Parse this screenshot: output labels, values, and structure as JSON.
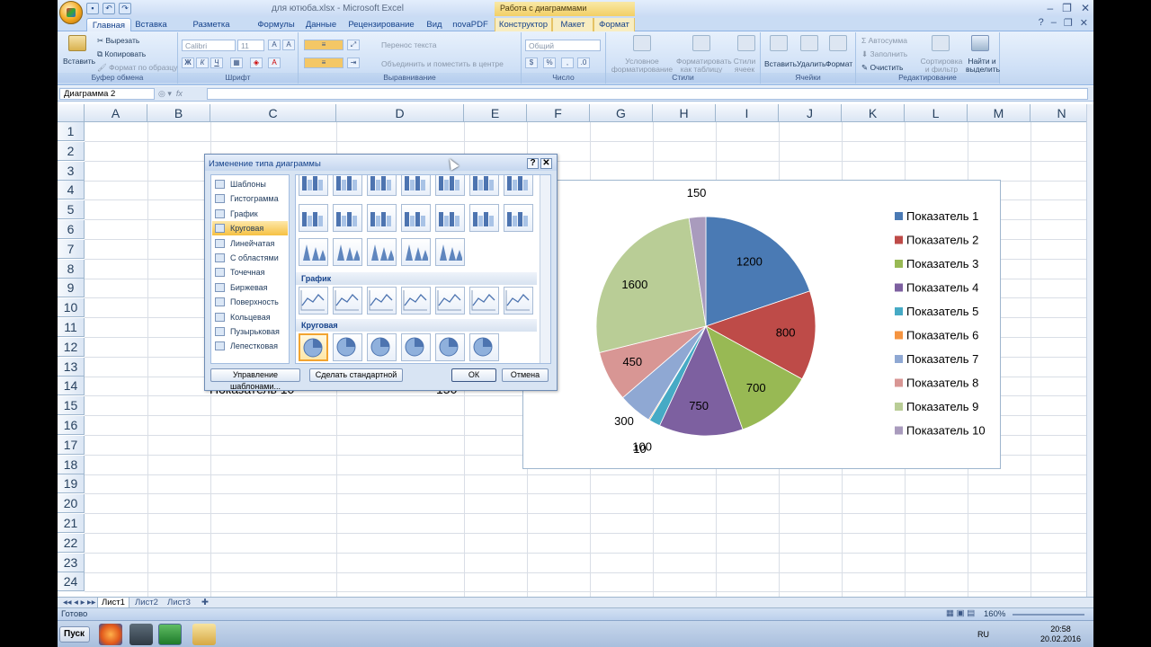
{
  "window": {
    "title": "для ютюба.xlsx - Microsoft Excel",
    "context_title": "Работа с диаграммами",
    "controls": [
      "–",
      "❐",
      "✕"
    ]
  },
  "tabs": [
    "Главная",
    "Вставка",
    "Разметка страницы",
    "Формулы",
    "Данные",
    "Рецензирование",
    "Вид",
    "novaPDF",
    "Конструктор",
    "Макет",
    "Формат"
  ],
  "ribbon": {
    "clipboard": {
      "paste": "Вставить",
      "cut": "Вырезать",
      "copy": "Копировать",
      "format": "Формат по образцу",
      "label": "Буфер обмена"
    },
    "font": {
      "name": "Calibri",
      "size": "11",
      "label": "Шрифт",
      "bold": "Ж",
      "italic": "К",
      "underline": "Ч"
    },
    "align": {
      "wrap": "Перенос текста",
      "merge": "Объединить и поместить в центре",
      "label": "Выравнивание"
    },
    "number": {
      "format": "Общий",
      "label": "Число"
    },
    "styles": {
      "conditional": "Условное форматирование",
      "as_table": "Форматировать как таблицу",
      "cell_styles": "Стили ячеек",
      "label": "Стили"
    },
    "cells": {
      "insert": "Вставить",
      "delete": "Удалить",
      "format": "Формат",
      "label": "Ячейки"
    },
    "editing": {
      "autosum": "Автосумма",
      "fill": "Заполнить",
      "clear": "Очистить",
      "sort": "Сортировка и фильтр",
      "find": "Найти и выделить",
      "label": "Редактирование"
    }
  },
  "formula_bar": {
    "name_box": "Диаграмма 2",
    "fx": "fx"
  },
  "columns": [
    "A",
    "B",
    "C",
    "D",
    "E",
    "F",
    "G",
    "H",
    "I",
    "J",
    "K",
    "L",
    "M",
    "N"
  ],
  "rows": [
    "1",
    "2",
    "3",
    "4",
    "5",
    "6",
    "7",
    "8",
    "9",
    "10",
    "11",
    "12",
    "13",
    "14",
    "15",
    "16",
    "17",
    "18",
    "19",
    "20",
    "21",
    "22",
    "23",
    "24"
  ],
  "cells": {
    "a14": "Показатель 10",
    "d14": "150"
  },
  "dialog": {
    "title": "Изменение типа диаграммы",
    "help": "?",
    "close": "✕",
    "categories": [
      "Шаблоны",
      "Гистограмма",
      "График",
      "Круговая",
      "Линейчатая",
      "С областями",
      "Точечная",
      "Биржевая",
      "Поверхность",
      "Кольцевая",
      "Пузырьковая",
      "Лепестковая"
    ],
    "selected_category": "Круговая",
    "section_line": "График",
    "section_pie": "Круговая",
    "btn_templates": "Управление шаблонами...",
    "btn_default": "Сделать стандартной",
    "btn_ok": "ОК",
    "btn_cancel": "Отмена"
  },
  "chart_data": {
    "type": "pie",
    "categories": [
      "Показатель  1",
      "Показатель 2",
      "Показатель 3",
      "Показатель 4",
      "Показатель 5",
      "Показатель 6",
      "Показатель 7",
      "Показатель 8",
      "Показатель 9",
      "Показатель 10"
    ],
    "values": [
      1200,
      800,
      700,
      750,
      100,
      10,
      300,
      450,
      1600,
      150
    ],
    "data_labels": [
      "1200",
      "800",
      "700",
      "750",
      "100",
      "10",
      "300",
      "450",
      "1600",
      "150"
    ],
    "colors": [
      "#4a7ab4",
      "#be4b48",
      "#98b954",
      "#7d60a0",
      "#46aac5",
      "#f59440",
      "#8fa8d3",
      "#d89694",
      "#b9cd96",
      "#a99bbd"
    ],
    "legend_position": "right"
  },
  "sheet_tabs": [
    "Лист1",
    "Лист2",
    "Лист3"
  ],
  "status": {
    "ready": "Готово",
    "zoom": "160%"
  },
  "taskbar": {
    "start": "Пуск",
    "lang": "RU",
    "time": "20:58",
    "date": "20.02.2016"
  }
}
